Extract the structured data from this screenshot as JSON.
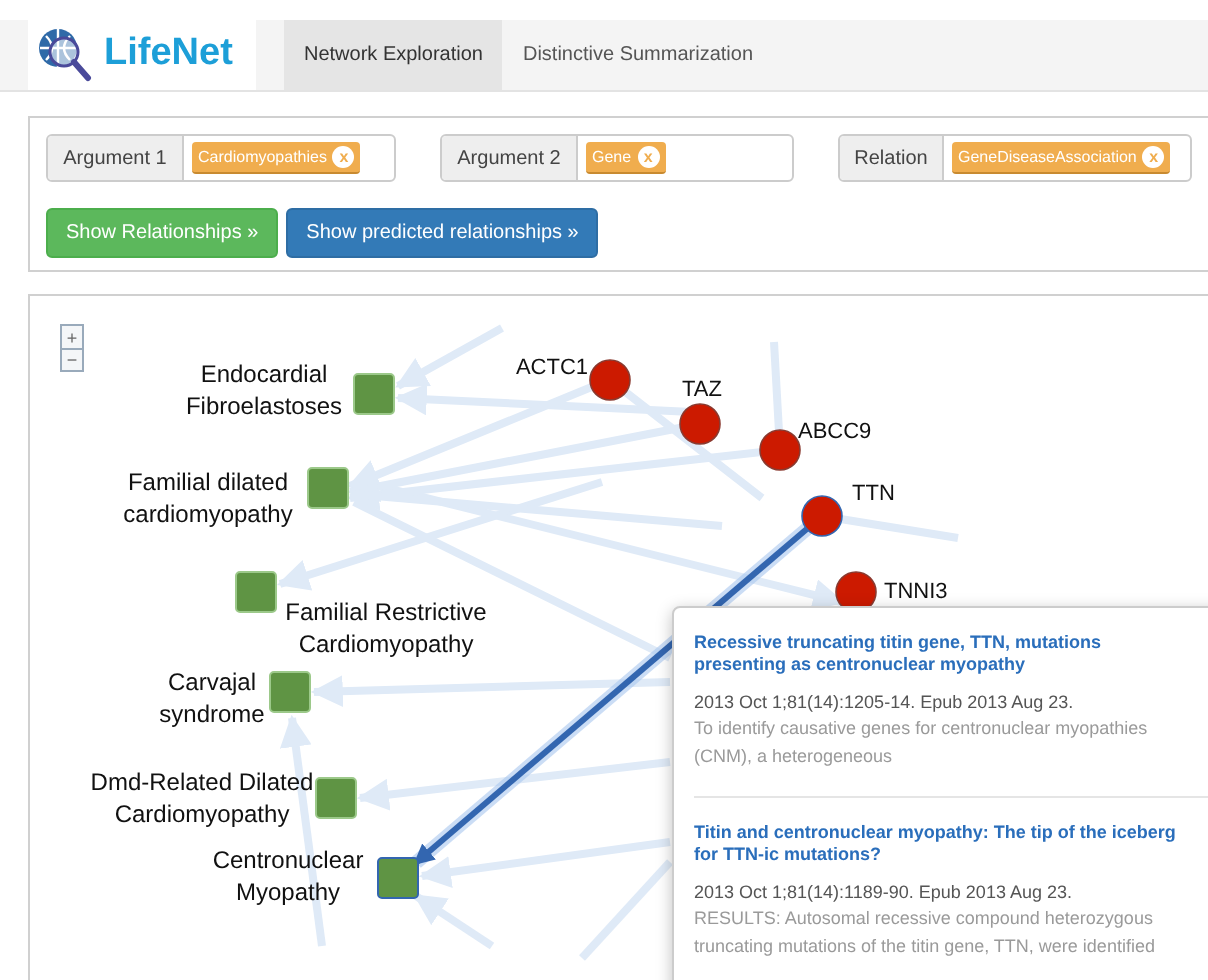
{
  "header": {
    "logo_text": "LifeNet",
    "tabs": [
      {
        "label": "Network Exploration",
        "selected": true
      },
      {
        "label": "Distinctive Summarization",
        "selected": false
      }
    ]
  },
  "filters": [
    {
      "label": "Argument 1",
      "tag": "Cardiomyopathies",
      "remove": "x"
    },
    {
      "label": "Argument 2",
      "tag": "Gene",
      "remove": "x"
    },
    {
      "label": "Relation",
      "tag": "GeneDiseaseAssociation",
      "remove": "x"
    }
  ],
  "buttons": [
    {
      "label": "Show Relationships »",
      "kind": "success"
    },
    {
      "label": "Show predicted relationships »",
      "kind": "primary"
    }
  ],
  "graph": {
    "zoom_controls": [
      "+",
      "−"
    ],
    "diseases": [
      {
        "label_lines": [
          "Endocardial",
          "Fibroelastoses"
        ],
        "highlighted": false
      },
      {
        "label_lines": [
          "Familial dilated",
          "cardiomyopathy"
        ],
        "highlighted": false
      },
      {
        "label_lines": [
          "Familial Restrictive",
          "Cardiomyopathy"
        ],
        "highlighted": false
      },
      {
        "label_lines": [
          "Carvajal",
          "syndrome"
        ],
        "highlighted": false
      },
      {
        "label_lines": [
          "Dmd-Related Dilated",
          "Cardiomyopathy"
        ],
        "highlighted": false
      },
      {
        "label_lines": [
          "Centronuclear",
          "Myopathy"
        ],
        "highlighted": true
      }
    ],
    "genes": [
      {
        "label": "ACTC1",
        "highlighted": false
      },
      {
        "label": "TAZ",
        "highlighted": false
      },
      {
        "label": "ABCC9",
        "highlighted": false
      },
      {
        "label": "TTN",
        "highlighted": true
      },
      {
        "label": "TNNI3",
        "highlighted": false
      }
    ],
    "popup": {
      "articles": [
        {
          "title": "Recessive truncating titin gene, TTN, mutations presenting as centronuclear myopathy",
          "citation": "2013 Oct 1;81(14):1205-14. Epub 2013 Aug 23.",
          "abstract": "To identify causative genes for centronuclear myopathies (CNM), a heterogeneous"
        },
        {
          "title": "Titin and centronuclear myopathy: The tip of the iceberg for TTN-ic mutations?",
          "citation": "2013 Oct 1;81(14):1189-90. Epub 2013 Aug 23.",
          "abstract": "RESULTS: Autosomal recessive compound heterozygous truncating mutations of the titin gene, TTN, were identified"
        }
      ]
    }
  }
}
